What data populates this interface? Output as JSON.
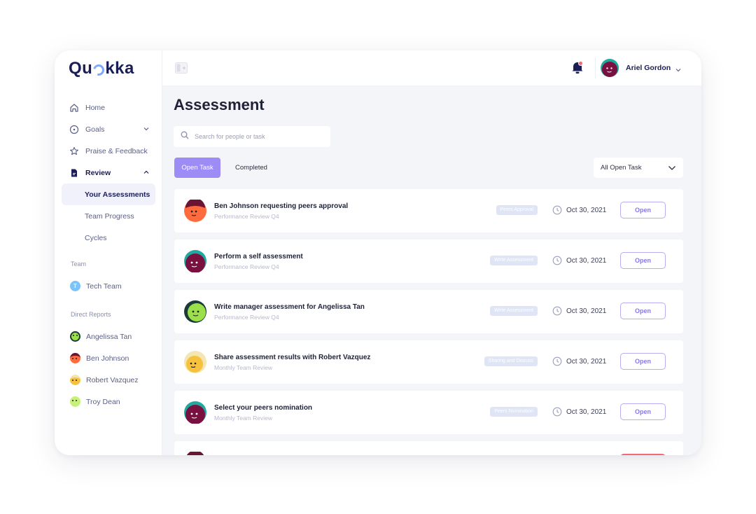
{
  "app": {
    "logo_text_a": "Qu",
    "logo_text_b": "kka"
  },
  "sidebar": {
    "nav": [
      {
        "label": "Home",
        "icon": "home-icon"
      },
      {
        "label": "Goals",
        "icon": "target-icon"
      },
      {
        "label": "Praise & Feedback",
        "icon": "star-icon"
      },
      {
        "label": "Review",
        "icon": "document-icon"
      }
    ],
    "review_sub": [
      "Your Assessments",
      "Team Progress",
      "Cycles"
    ],
    "team_label": "Team",
    "team": {
      "initial": "T",
      "name": "Tech Team"
    },
    "direct_reports_label": "Direct Reports",
    "direct_reports": [
      "Angelissa Tan",
      "Ben Johnson",
      "Robert Vazquez",
      "Troy Dean"
    ]
  },
  "topbar": {
    "user_name": "Ariel Gordon"
  },
  "main": {
    "title": "Assessment",
    "search_placeholder": "Search for people or task",
    "tabs": [
      "Open Task",
      "Completed"
    ],
    "filter": "All Open Task",
    "tasks": [
      {
        "title": "Ben Johnson requesting peers approval",
        "subtitle": "Performance Review Q4",
        "badge": "Peers Approval",
        "date": "Oct 30, 2021",
        "action": "Open"
      },
      {
        "title": "Perform a self assessment",
        "subtitle": "Performance Review Q4",
        "badge": "Write Assessment",
        "date": "Oct 30, 2021",
        "action": "Open"
      },
      {
        "title": "Write manager assessment for Angelissa Tan",
        "subtitle": "Performance Review Q4",
        "badge": "Write Assessment",
        "date": "Oct 30, 2021",
        "action": "Open"
      },
      {
        "title": "Share assessment results with Robert Vazquez",
        "subtitle": "Monthly Team Review",
        "badge": "Sharing and Discuss",
        "date": "Oct 30, 2021",
        "action": "Open"
      },
      {
        "title": "Select your peers nomination",
        "subtitle": "Monthly Team Review",
        "badge": "Peers Nomination",
        "date": "Oct 30, 2021",
        "action": "Open"
      }
    ]
  },
  "colors": {
    "brand_navy": "#1b1e56",
    "accent_purple": "#9d8cf5",
    "badge_bg": "#dfe5f5",
    "open_border": "#b7adf5",
    "alert_red": "#f06a77"
  }
}
